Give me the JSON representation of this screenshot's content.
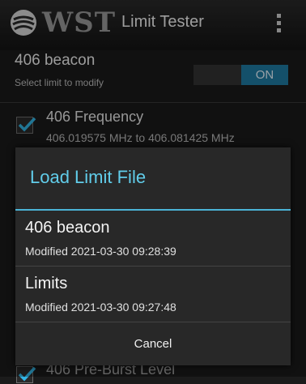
{
  "actionbar": {
    "logo_text": "WST",
    "title": "Limit Tester",
    "overflow_icon": "overflow-menu-icon"
  },
  "background": {
    "profile_title": "406 beacon",
    "profile_subtitle": "Select limit to modify",
    "toggle_state": "ON",
    "rows": [
      {
        "title": "406 Frequency",
        "subtitle": "406.019575 MHz to 406.081425 MHz",
        "checked": true
      },
      {
        "title": "406 Pre-Burst Level",
        "checked": true
      }
    ]
  },
  "dialog": {
    "title": "Load Limit File",
    "items": [
      {
        "name": "406 beacon",
        "modified": "Modified 2021-03-30 09:28:39"
      },
      {
        "name": "Limits",
        "modified": "Modified 2021-03-30 09:27:48"
      }
    ],
    "cancel_label": "Cancel"
  },
  "colors": {
    "accent": "#4bb3d6",
    "dialog_title": "#61cdea",
    "toggle_on": "#1f7ba3"
  }
}
